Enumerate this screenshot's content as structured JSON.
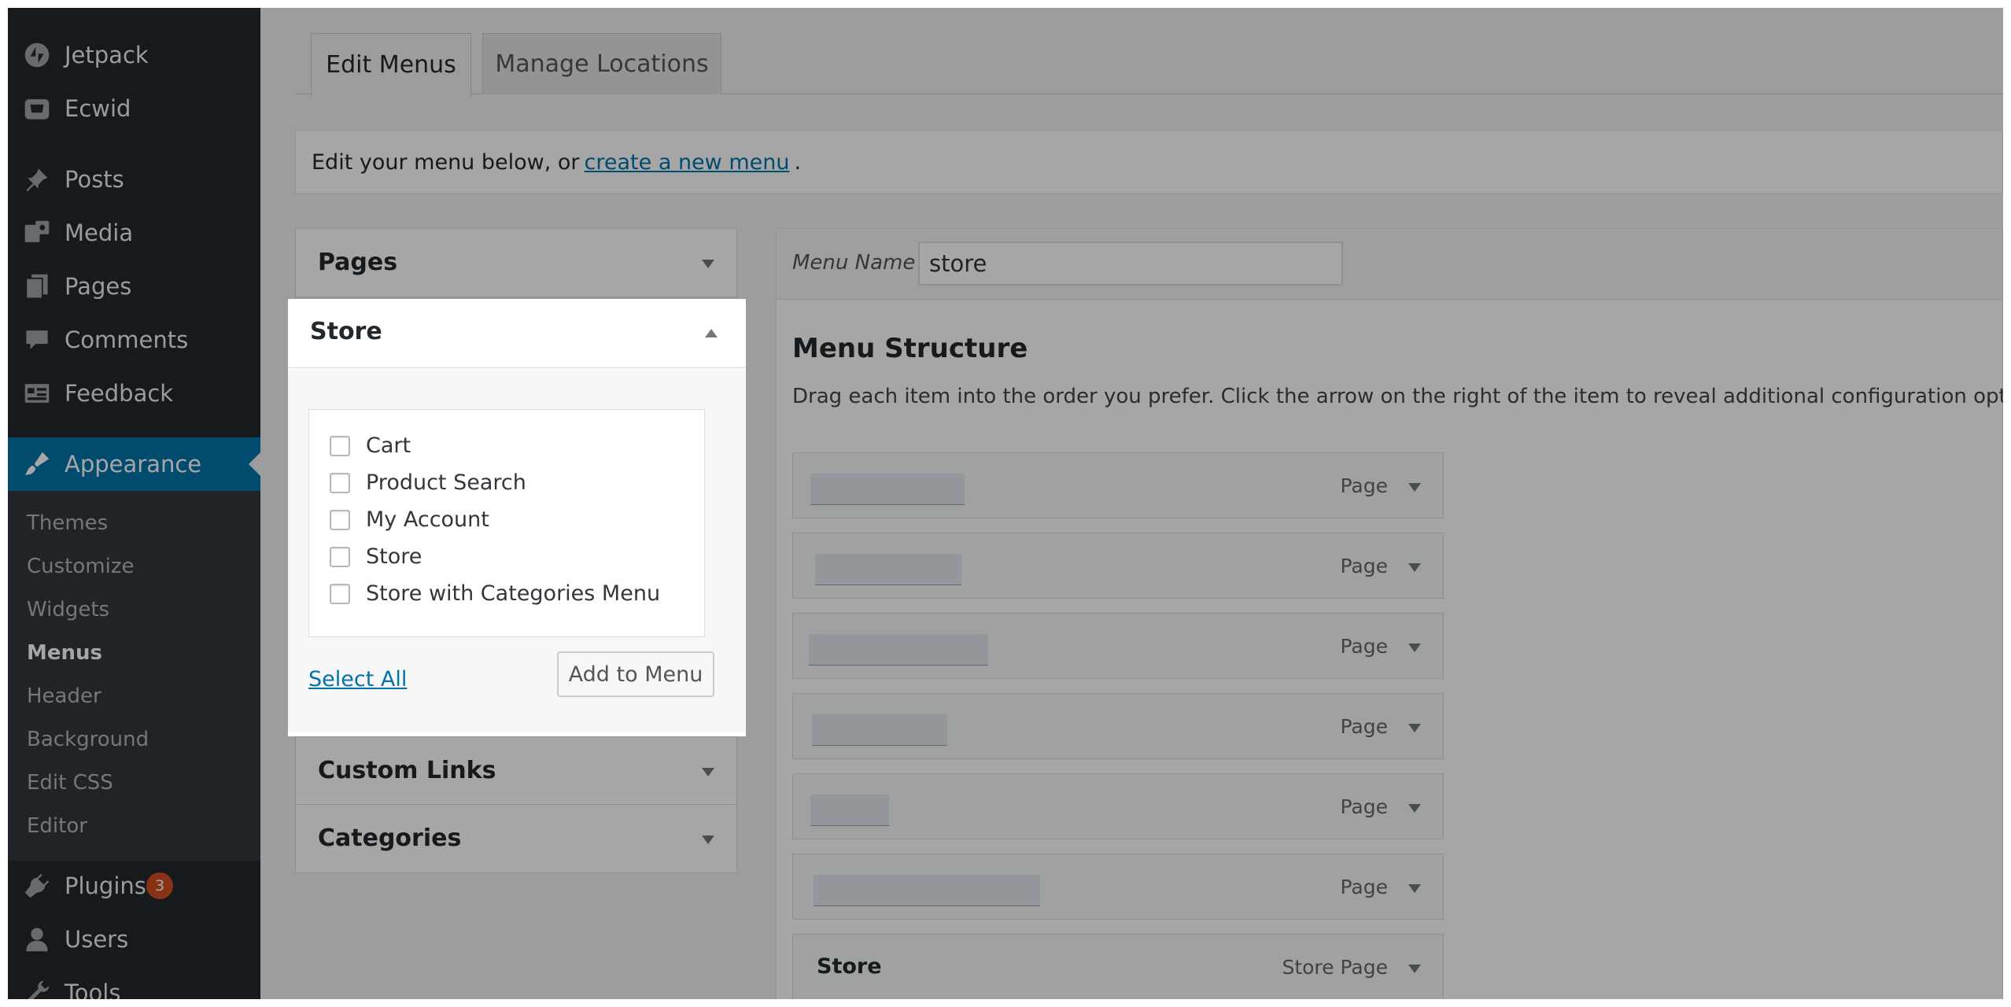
{
  "sidebar": {
    "top_items": [
      {
        "label": "Jetpack",
        "icon": "jetpack-icon"
      },
      {
        "label": "Ecwid",
        "icon": "ecwid-icon"
      },
      {
        "label": "Posts",
        "icon": "pin-icon"
      },
      {
        "label": "Media",
        "icon": "media-icon"
      },
      {
        "label": "Pages",
        "icon": "pages-icon"
      },
      {
        "label": "Comments",
        "icon": "comment-icon"
      },
      {
        "label": "Feedback",
        "icon": "feedback-icon"
      }
    ],
    "appearance": {
      "label": "Appearance",
      "icon": "paintbrush-icon"
    },
    "submenu": [
      "Themes",
      "Customize",
      "Widgets",
      "Menus",
      "Header",
      "Background",
      "Edit CSS",
      "Editor"
    ],
    "current_submenu": "Menus",
    "bottom_items": [
      {
        "label": "Plugins",
        "icon": "plugin-icon",
        "badge": "3"
      },
      {
        "label": "Users",
        "icon": "user-icon"
      },
      {
        "label": "Tools",
        "icon": "wrench-icon"
      }
    ],
    "active_color": "#0073aa",
    "badge_color": "#d54e21"
  },
  "tabs": {
    "edit": "Edit Menus",
    "manage": "Manage Locations"
  },
  "notice": {
    "prefix": "Edit your menu below, or",
    "link": "create a new menu",
    "suffix": "."
  },
  "accordion": {
    "pages": "Pages",
    "store": "Store",
    "custom_links": "Custom Links",
    "categories": "Categories"
  },
  "store_panel": {
    "items": [
      "Cart",
      "Product Search",
      "My Account",
      "Store",
      "Store with Categories Menu"
    ],
    "select_all": "Select All",
    "add_button": "Add to Menu"
  },
  "menu": {
    "name_label": "Menu Name",
    "name_value": "store",
    "structure_title": "Menu Structure",
    "instructions": "Drag each item into the order you prefer. Click the arrow on the right of the item to reveal additional configuration options.",
    "rows": [
      {
        "title": "",
        "type": "Page"
      },
      {
        "title": "",
        "type": "Page"
      },
      {
        "title": "",
        "type": "Page"
      },
      {
        "title": "",
        "type": "Page"
      },
      {
        "title": "",
        "type": "Page"
      },
      {
        "title": "",
        "type": "Page"
      },
      {
        "title": "Store",
        "type": "Store Page"
      }
    ]
  }
}
